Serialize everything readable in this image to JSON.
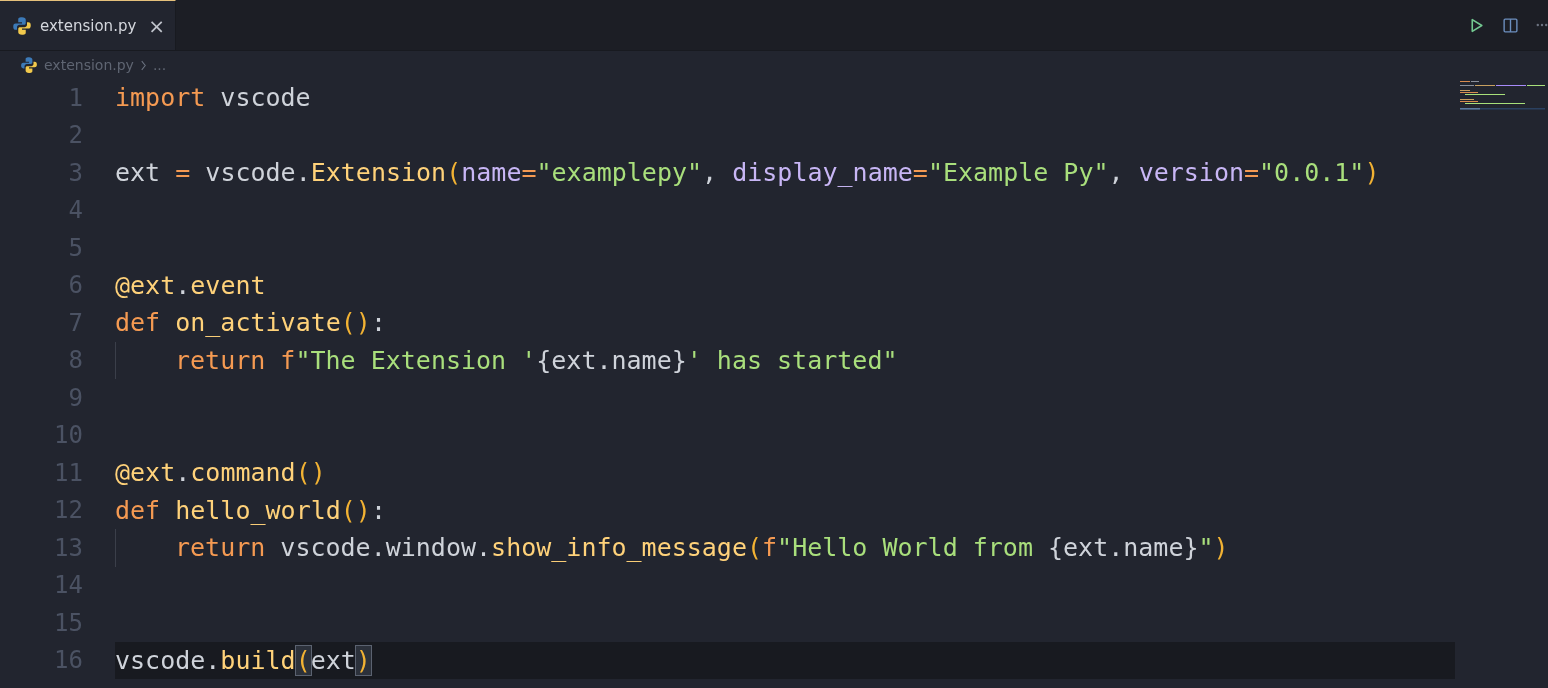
{
  "tabs": [
    {
      "label": "extension.py",
      "close": "×",
      "selected": true
    }
  ],
  "breadcrumb": {
    "file": "extension.py",
    "more": "..."
  },
  "editor": {
    "lines": [
      {
        "number": "1",
        "current": false,
        "indented": false,
        "tokens": [
          {
            "kind": "keyword",
            "text": "import"
          },
          {
            "kind": "plain",
            "text": " vscode"
          }
        ]
      },
      {
        "number": "2",
        "current": false,
        "indented": false
      },
      {
        "number": "3",
        "current": false,
        "indented": false,
        "tokens": [
          {
            "kind": "plain",
            "text": "ext "
          },
          {
            "kind": "operator",
            "text": "="
          },
          {
            "kind": "plain",
            "text": " vscode."
          },
          {
            "kind": "function",
            "text": "Extension"
          },
          {
            "kind": "bracket",
            "text": "("
          },
          {
            "kind": "parameter",
            "text": "name"
          },
          {
            "kind": "operator",
            "text": "="
          },
          {
            "kind": "string",
            "text": "\"examplepy\""
          },
          {
            "kind": "plain",
            "text": ", "
          },
          {
            "kind": "parameter",
            "text": "display_name"
          },
          {
            "kind": "operator",
            "text": "="
          },
          {
            "kind": "string",
            "text": "\"Example Py\""
          },
          {
            "kind": "plain",
            "text": ", "
          },
          {
            "kind": "parameter",
            "text": "version"
          },
          {
            "kind": "operator",
            "text": "="
          },
          {
            "kind": "string",
            "text": "\"0.0.1\""
          },
          {
            "kind": "bracket",
            "text": ")"
          }
        ]
      },
      {
        "number": "4",
        "current": false,
        "indented": false
      },
      {
        "number": "5",
        "current": false,
        "indented": false
      },
      {
        "number": "6",
        "current": false,
        "indented": false,
        "tokens": [
          {
            "kind": "decorator",
            "text": "@ext"
          },
          {
            "kind": "plain",
            "text": "."
          },
          {
            "kind": "decorator",
            "text": "event"
          }
        ]
      },
      {
        "number": "7",
        "current": false,
        "indented": false,
        "tokens": [
          {
            "kind": "keyword",
            "text": "def "
          },
          {
            "kind": "function",
            "text": "on_activate"
          },
          {
            "kind": "bracket",
            "text": "()"
          },
          {
            "kind": "plain",
            "text": ":"
          }
        ]
      },
      {
        "number": "8",
        "current": false,
        "indented": true,
        "tokens": [
          {
            "kind": "keyword",
            "text": "return "
          },
          {
            "kind": "keyword",
            "text": "f"
          },
          {
            "kind": "string",
            "text": "\"The Extension '"
          },
          {
            "kind": "plain",
            "text": "{ext.name}"
          },
          {
            "kind": "string",
            "text": "' has started\""
          }
        ]
      },
      {
        "number": "9",
        "current": false,
        "indented": false
      },
      {
        "number": "10",
        "current": false,
        "indented": false
      },
      {
        "number": "11",
        "current": false,
        "indented": false,
        "tokens": [
          {
            "kind": "decorator",
            "text": "@ext"
          },
          {
            "kind": "plain",
            "text": "."
          },
          {
            "kind": "decorator",
            "text": "command"
          },
          {
            "kind": "bracket",
            "text": "()"
          }
        ]
      },
      {
        "number": "12",
        "current": false,
        "indented": false,
        "tokens": [
          {
            "kind": "keyword",
            "text": "def "
          },
          {
            "kind": "function",
            "text": "hello_world"
          },
          {
            "kind": "bracket",
            "text": "()"
          },
          {
            "kind": "plain",
            "text": ":"
          }
        ]
      },
      {
        "number": "13",
        "current": false,
        "indented": true,
        "tokens": [
          {
            "kind": "keyword",
            "text": "return "
          },
          {
            "kind": "plain",
            "text": "vscode.window."
          },
          {
            "kind": "function",
            "text": "show_info_message"
          },
          {
            "kind": "bracket",
            "text": "("
          },
          {
            "kind": "keyword",
            "text": "f"
          },
          {
            "kind": "string",
            "text": "\"Hello World from "
          },
          {
            "kind": "plain",
            "text": "{ext.name}"
          },
          {
            "kind": "string",
            "text": "\""
          },
          {
            "kind": "bracket",
            "text": ")"
          }
        ]
      },
      {
        "number": "14",
        "current": false,
        "indented": false
      },
      {
        "number": "15",
        "current": false,
        "indented": false
      },
      {
        "number": "16",
        "current": true,
        "indented": false,
        "tokens": [
          {
            "kind": "plain",
            "text": "vscode."
          },
          {
            "kind": "function",
            "text": "build"
          },
          {
            "kind": "matched_bracket",
            "text": "("
          },
          {
            "kind": "plain",
            "text": "ext"
          },
          {
            "kind": "matched_bracket",
            "text": ")"
          }
        ]
      }
    ]
  }
}
